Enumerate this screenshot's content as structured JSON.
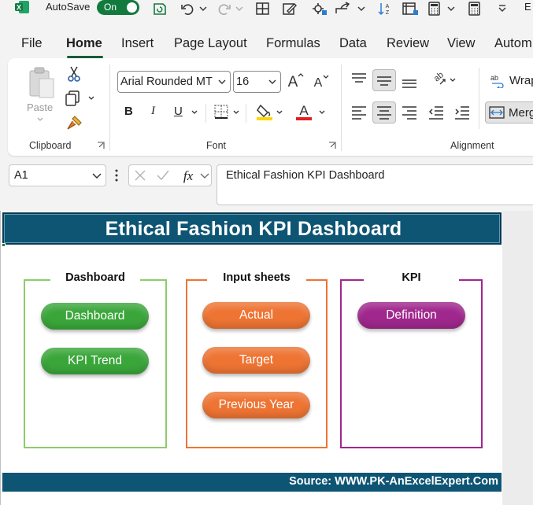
{
  "titlebar": {
    "autosave_label": "AutoSave",
    "autosave_state": "On",
    "trailing_text": "E"
  },
  "tabs": [
    {
      "label": "File"
    },
    {
      "label": "Home"
    },
    {
      "label": "Insert"
    },
    {
      "label": "Page Layout"
    },
    {
      "label": "Formulas"
    },
    {
      "label": "Data"
    },
    {
      "label": "Review"
    },
    {
      "label": "View"
    },
    {
      "label": "Autom"
    }
  ],
  "ribbon": {
    "clipboard": {
      "label": "Clipboard",
      "paste_label": "Paste"
    },
    "font": {
      "label": "Font",
      "font_name": "Arial Rounded MT",
      "font_size": "16",
      "bold": "B",
      "italic": "I",
      "underline": "U"
    },
    "alignment": {
      "label": "Alignment",
      "wrap_label": "Wrap",
      "merge_label": "Merg"
    }
  },
  "formula_bar": {
    "name_box": "A1",
    "formula": "Ethical Fashion KPI Dashboard"
  },
  "sheet": {
    "title": "Ethical Fashion KPI Dashboard",
    "groups": [
      {
        "title": "Dashboard",
        "buttons": [
          "Dashboard",
          "KPI Trend"
        ]
      },
      {
        "title": "Input sheets",
        "buttons": [
          "Actual",
          "Target",
          "Previous Year"
        ]
      },
      {
        "title": "KPI",
        "buttons": [
          "Definition"
        ]
      }
    ],
    "footer": "Source: WWW.PK-AnExcelExpert.Com"
  },
  "colors": {
    "excel_green": "#137a3e",
    "banner": "#0e5574",
    "green_group": "#8ccc6a",
    "green_button": "#3aa63a",
    "orange_group": "#ee7433",
    "orange_button": "#ee7433",
    "purple_group": "#a0278d",
    "purple_button": "#a0278d",
    "highlight_yellow": "#ffd700",
    "font_red": "#e02020"
  },
  "icons": [
    "excel-icon",
    "save-icon",
    "undo-icon",
    "redo-icon",
    "table-icon",
    "edit-icon",
    "settings-icon",
    "share-icon",
    "calculator-icon",
    "cut-icon",
    "copy-icon",
    "format-painter-icon",
    "borders-icon",
    "fill-color-icon",
    "font-color-icon",
    "align-top-icon",
    "align-middle-icon",
    "align-bottom-icon",
    "orientation-icon",
    "align-left-icon",
    "align-center-icon",
    "align-right-icon",
    "indent-decrease-icon",
    "indent-increase-icon",
    "wrap-text-icon",
    "merge-icon",
    "cancel-icon",
    "enter-icon",
    "function-icon"
  ]
}
